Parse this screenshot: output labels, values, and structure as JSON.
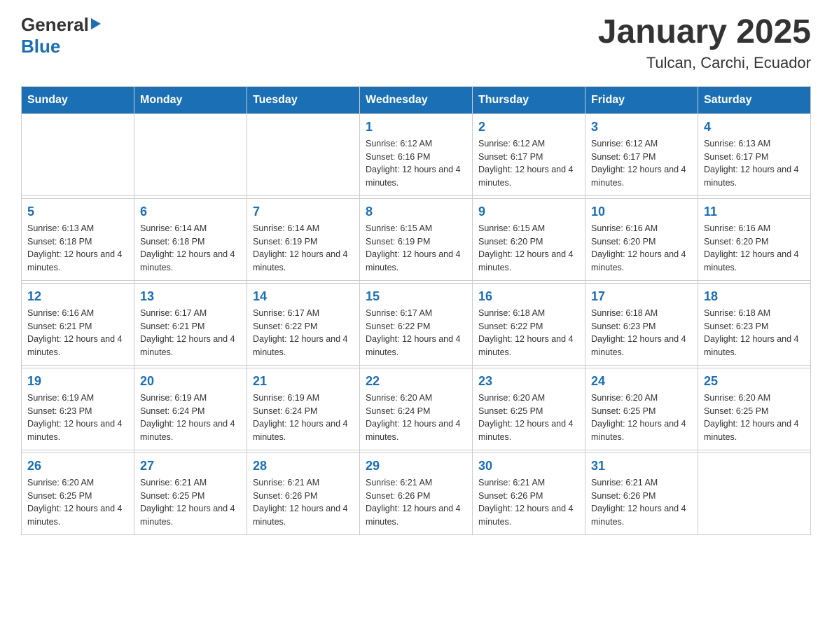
{
  "header": {
    "logo_general": "General",
    "logo_blue": "Blue",
    "title": "January 2025",
    "location": "Tulcan, Carchi, Ecuador"
  },
  "days_of_week": [
    "Sunday",
    "Monday",
    "Tuesday",
    "Wednesday",
    "Thursday",
    "Friday",
    "Saturday"
  ],
  "weeks": [
    {
      "days": [
        {
          "num": "",
          "info": ""
        },
        {
          "num": "",
          "info": ""
        },
        {
          "num": "",
          "info": ""
        },
        {
          "num": "1",
          "info": "Sunrise: 6:12 AM\nSunset: 6:16 PM\nDaylight: 12 hours and 4 minutes."
        },
        {
          "num": "2",
          "info": "Sunrise: 6:12 AM\nSunset: 6:17 PM\nDaylight: 12 hours and 4 minutes."
        },
        {
          "num": "3",
          "info": "Sunrise: 6:12 AM\nSunset: 6:17 PM\nDaylight: 12 hours and 4 minutes."
        },
        {
          "num": "4",
          "info": "Sunrise: 6:13 AM\nSunset: 6:17 PM\nDaylight: 12 hours and 4 minutes."
        }
      ]
    },
    {
      "days": [
        {
          "num": "5",
          "info": "Sunrise: 6:13 AM\nSunset: 6:18 PM\nDaylight: 12 hours and 4 minutes."
        },
        {
          "num": "6",
          "info": "Sunrise: 6:14 AM\nSunset: 6:18 PM\nDaylight: 12 hours and 4 minutes."
        },
        {
          "num": "7",
          "info": "Sunrise: 6:14 AM\nSunset: 6:19 PM\nDaylight: 12 hours and 4 minutes."
        },
        {
          "num": "8",
          "info": "Sunrise: 6:15 AM\nSunset: 6:19 PM\nDaylight: 12 hours and 4 minutes."
        },
        {
          "num": "9",
          "info": "Sunrise: 6:15 AM\nSunset: 6:20 PM\nDaylight: 12 hours and 4 minutes."
        },
        {
          "num": "10",
          "info": "Sunrise: 6:16 AM\nSunset: 6:20 PM\nDaylight: 12 hours and 4 minutes."
        },
        {
          "num": "11",
          "info": "Sunrise: 6:16 AM\nSunset: 6:20 PM\nDaylight: 12 hours and 4 minutes."
        }
      ]
    },
    {
      "days": [
        {
          "num": "12",
          "info": "Sunrise: 6:16 AM\nSunset: 6:21 PM\nDaylight: 12 hours and 4 minutes."
        },
        {
          "num": "13",
          "info": "Sunrise: 6:17 AM\nSunset: 6:21 PM\nDaylight: 12 hours and 4 minutes."
        },
        {
          "num": "14",
          "info": "Sunrise: 6:17 AM\nSunset: 6:22 PM\nDaylight: 12 hours and 4 minutes."
        },
        {
          "num": "15",
          "info": "Sunrise: 6:17 AM\nSunset: 6:22 PM\nDaylight: 12 hours and 4 minutes."
        },
        {
          "num": "16",
          "info": "Sunrise: 6:18 AM\nSunset: 6:22 PM\nDaylight: 12 hours and 4 minutes."
        },
        {
          "num": "17",
          "info": "Sunrise: 6:18 AM\nSunset: 6:23 PM\nDaylight: 12 hours and 4 minutes."
        },
        {
          "num": "18",
          "info": "Sunrise: 6:18 AM\nSunset: 6:23 PM\nDaylight: 12 hours and 4 minutes."
        }
      ]
    },
    {
      "days": [
        {
          "num": "19",
          "info": "Sunrise: 6:19 AM\nSunset: 6:23 PM\nDaylight: 12 hours and 4 minutes."
        },
        {
          "num": "20",
          "info": "Sunrise: 6:19 AM\nSunset: 6:24 PM\nDaylight: 12 hours and 4 minutes."
        },
        {
          "num": "21",
          "info": "Sunrise: 6:19 AM\nSunset: 6:24 PM\nDaylight: 12 hours and 4 minutes."
        },
        {
          "num": "22",
          "info": "Sunrise: 6:20 AM\nSunset: 6:24 PM\nDaylight: 12 hours and 4 minutes."
        },
        {
          "num": "23",
          "info": "Sunrise: 6:20 AM\nSunset: 6:25 PM\nDaylight: 12 hours and 4 minutes."
        },
        {
          "num": "24",
          "info": "Sunrise: 6:20 AM\nSunset: 6:25 PM\nDaylight: 12 hours and 4 minutes."
        },
        {
          "num": "25",
          "info": "Sunrise: 6:20 AM\nSunset: 6:25 PM\nDaylight: 12 hours and 4 minutes."
        }
      ]
    },
    {
      "days": [
        {
          "num": "26",
          "info": "Sunrise: 6:20 AM\nSunset: 6:25 PM\nDaylight: 12 hours and 4 minutes."
        },
        {
          "num": "27",
          "info": "Sunrise: 6:21 AM\nSunset: 6:25 PM\nDaylight: 12 hours and 4 minutes."
        },
        {
          "num": "28",
          "info": "Sunrise: 6:21 AM\nSunset: 6:26 PM\nDaylight: 12 hours and 4 minutes."
        },
        {
          "num": "29",
          "info": "Sunrise: 6:21 AM\nSunset: 6:26 PM\nDaylight: 12 hours and 4 minutes."
        },
        {
          "num": "30",
          "info": "Sunrise: 6:21 AM\nSunset: 6:26 PM\nDaylight: 12 hours and 4 minutes."
        },
        {
          "num": "31",
          "info": "Sunrise: 6:21 AM\nSunset: 6:26 PM\nDaylight: 12 hours and 4 minutes."
        },
        {
          "num": "",
          "info": ""
        }
      ]
    }
  ]
}
